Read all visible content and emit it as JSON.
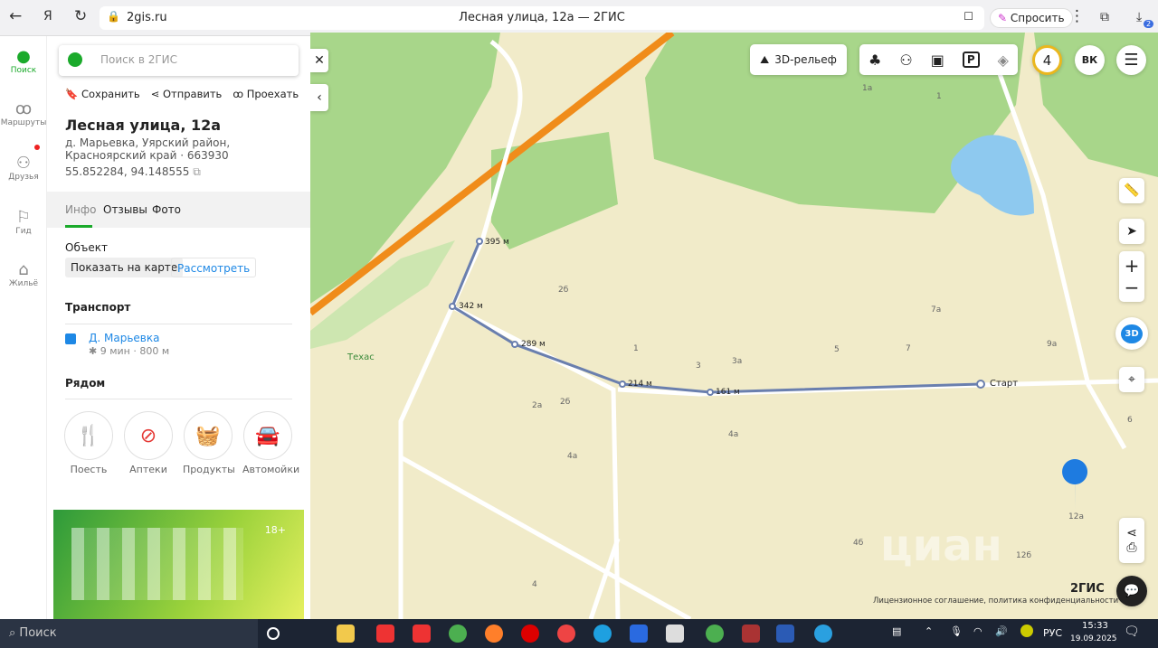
{
  "browser": {
    "url": "2gis.ru",
    "tab_title": "Лесная улица, 12а — 2ГИС",
    "ask": "Спросить",
    "badge": "2"
  },
  "rail": [
    {
      "label": "Поиск",
      "icon": "pin-icon"
    },
    {
      "label": "Маршруты",
      "icon": "routes-icon"
    },
    {
      "label": "Друзья",
      "icon": "friends-icon"
    },
    {
      "label": "Гид",
      "icon": "flag-icon"
    },
    {
      "label": "Жильё",
      "icon": "house-icon"
    }
  ],
  "panel": {
    "search_placeholder": "Поиск в 2ГИС",
    "actions": {
      "save": "Сохранить",
      "share": "Отправить",
      "route": "Проехать"
    },
    "title": "Лесная улица, 12а",
    "address": "д. Марьевка, Уярский район, Красноярский край · 663930",
    "coords": "55.852284, 94.148555",
    "tabs": [
      "Инфо",
      "Отзывы",
      "Фото"
    ],
    "object_label": "Объект",
    "show_on_map": "Показать на карте",
    "view": "Рассмотреть",
    "transport_label": "Транспорт",
    "stop_name": "Д. Марьевка",
    "stop_info": "9 мин · 800 м",
    "nearby_label": "Рядом",
    "nearby": [
      {
        "label": "Поесть",
        "icon": "fork-knife-icon",
        "color": "#f39c12"
      },
      {
        "label": "Аптеки",
        "icon": "pill-icon",
        "color": "#e53935"
      },
      {
        "label": "Продукты",
        "icon": "basket-icon",
        "color": "#43a047"
      },
      {
        "label": "Автомойки",
        "icon": "car-wash-icon",
        "color": "#1e88e5"
      }
    ],
    "ad_age": "18+"
  },
  "map": {
    "relief": "3D-рельеф",
    "badge_number": "4",
    "vk": "ВК",
    "mode_3d": "3D",
    "route_labels": [
      "395 м",
      "342 м",
      "289 м",
      "214 м",
      "161 м",
      "Старт"
    ],
    "poi": "Техас",
    "house_numbers": [
      "1а",
      "1",
      "2б",
      "1",
      "5",
      "7",
      "7а",
      "3",
      "3а",
      "9а",
      "2а",
      "2б",
      "4а",
      "4а",
      "6",
      "12а",
      "4б",
      "12б",
      "4"
    ],
    "brand": "2ГИС",
    "license": "Лицензионное соглашение, политика конфиденциальности",
    "watermark": "циан"
  },
  "taskbar": {
    "search": "Поиск",
    "lang": "РУС",
    "time": "15:33",
    "date": "19.09.2025"
  }
}
